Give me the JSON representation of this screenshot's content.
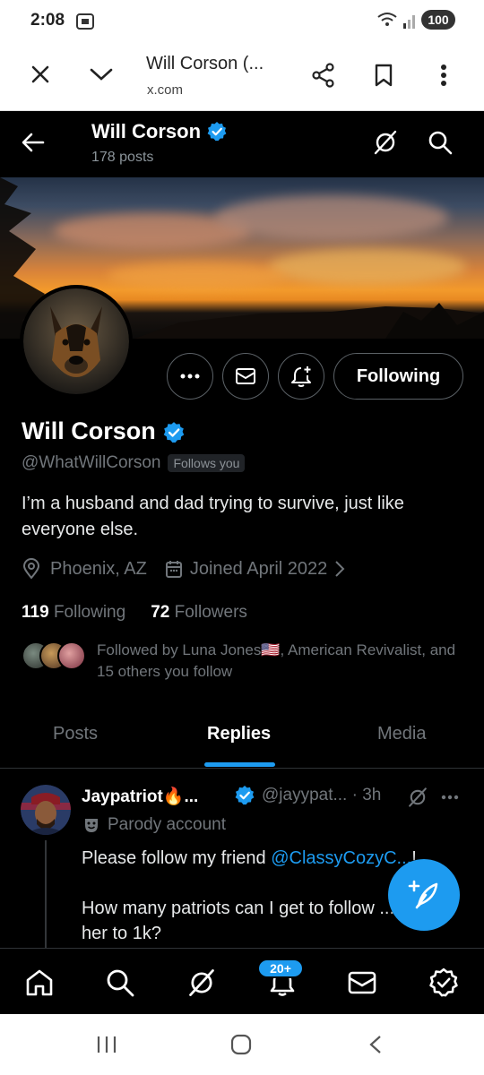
{
  "status_bar": {
    "time": "2:08",
    "battery": "100"
  },
  "browser": {
    "title": "Will Corson (...",
    "url": "x.com"
  },
  "header": {
    "name": "Will Corson",
    "posts": "178 posts"
  },
  "profile": {
    "name": "Will Corson",
    "handle": "@WhatWillCorson",
    "follows_you": "Follows you",
    "bio": "I’m a husband and dad trying to survive, just like everyone else.",
    "location": "Phoenix, AZ",
    "joined": "Joined April 2022",
    "following_count": "119",
    "following_label": "Following",
    "followers_count": "72",
    "followers_label": "Followers",
    "followed_by": "Followed by Luna Jones🇺🇸, American Revivalist, and 15 others you follow",
    "following_button": "Following"
  },
  "tabs": [
    {
      "label": "Posts",
      "active": false
    },
    {
      "label": "Replies",
      "active": true
    },
    {
      "label": "Media",
      "active": false
    }
  ],
  "tweet": {
    "name": "Jaypatriot🔥...",
    "handle": "@jayypat... · 3h",
    "parody": "Parody account",
    "text_before": "Please follow my friend ",
    "mention": "@ClassyCozyC...",
    "text_after": "!",
    "text_line2": "How many patriots can I get to follow ... to get her to 1k?"
  },
  "nav": {
    "notification_badge": "20+"
  },
  "colors": {
    "accent": "#1d9bf0",
    "background": "#000000",
    "muted": "#71767b"
  }
}
